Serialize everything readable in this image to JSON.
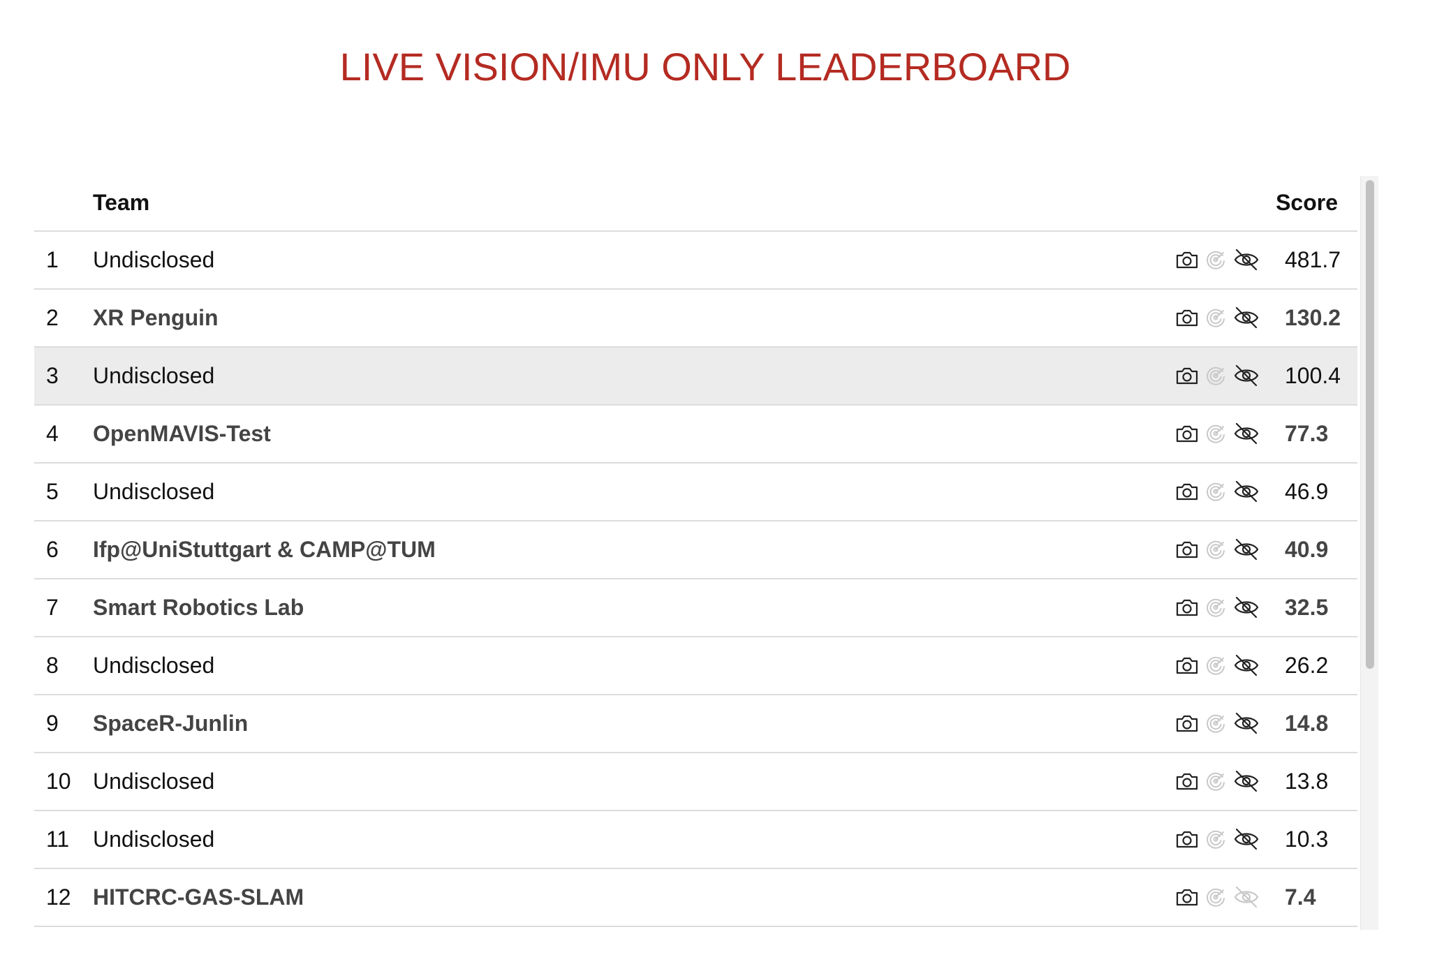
{
  "page": {
    "title": "LIVE VISION/IMU ONLY LEADERBOARD"
  },
  "colors": {
    "title": "#b42b22",
    "row_border": "#dcdcdc",
    "highlight_row": "#ececec",
    "icon_dark": "#222222",
    "icon_light": "#c8c8c8"
  },
  "table": {
    "headers": {
      "rank": "",
      "team": "Team",
      "score": "Score"
    },
    "highlighted_row": 3,
    "icon_names": [
      "camera-icon",
      "imu-sensor-icon",
      "eye-off-icon"
    ],
    "rows": [
      {
        "rank": "1",
        "team": "Undisclosed",
        "score": "481.7",
        "disclosed": false,
        "eye_off_active": true
      },
      {
        "rank": "2",
        "team": "XR Penguin",
        "score": "130.2",
        "disclosed": true,
        "eye_off_active": true
      },
      {
        "rank": "3",
        "team": "Undisclosed",
        "score": "100.4",
        "disclosed": false,
        "eye_off_active": true
      },
      {
        "rank": "4",
        "team": "OpenMAVIS-Test",
        "score": "77.3",
        "disclosed": true,
        "eye_off_active": true
      },
      {
        "rank": "5",
        "team": "Undisclosed",
        "score": "46.9",
        "disclosed": false,
        "eye_off_active": true
      },
      {
        "rank": "6",
        "team": "Ifp@UniStuttgart & CAMP@TUM",
        "score": "40.9",
        "disclosed": true,
        "eye_off_active": true
      },
      {
        "rank": "7",
        "team": "Smart Robotics Lab",
        "score": "32.5",
        "disclosed": true,
        "eye_off_active": true
      },
      {
        "rank": "8",
        "team": "Undisclosed",
        "score": "26.2",
        "disclosed": false,
        "eye_off_active": true
      },
      {
        "rank": "9",
        "team": "SpaceR-Junlin",
        "score": "14.8",
        "disclosed": true,
        "eye_off_active": true
      },
      {
        "rank": "10",
        "team": "Undisclosed",
        "score": "13.8",
        "disclosed": false,
        "eye_off_active": true
      },
      {
        "rank": "11",
        "team": "Undisclosed",
        "score": "10.3",
        "disclosed": false,
        "eye_off_active": true
      },
      {
        "rank": "12",
        "team": "HITCRC-GAS-SLAM",
        "score": "7.4",
        "disclosed": true,
        "eye_off_active": false
      }
    ]
  }
}
